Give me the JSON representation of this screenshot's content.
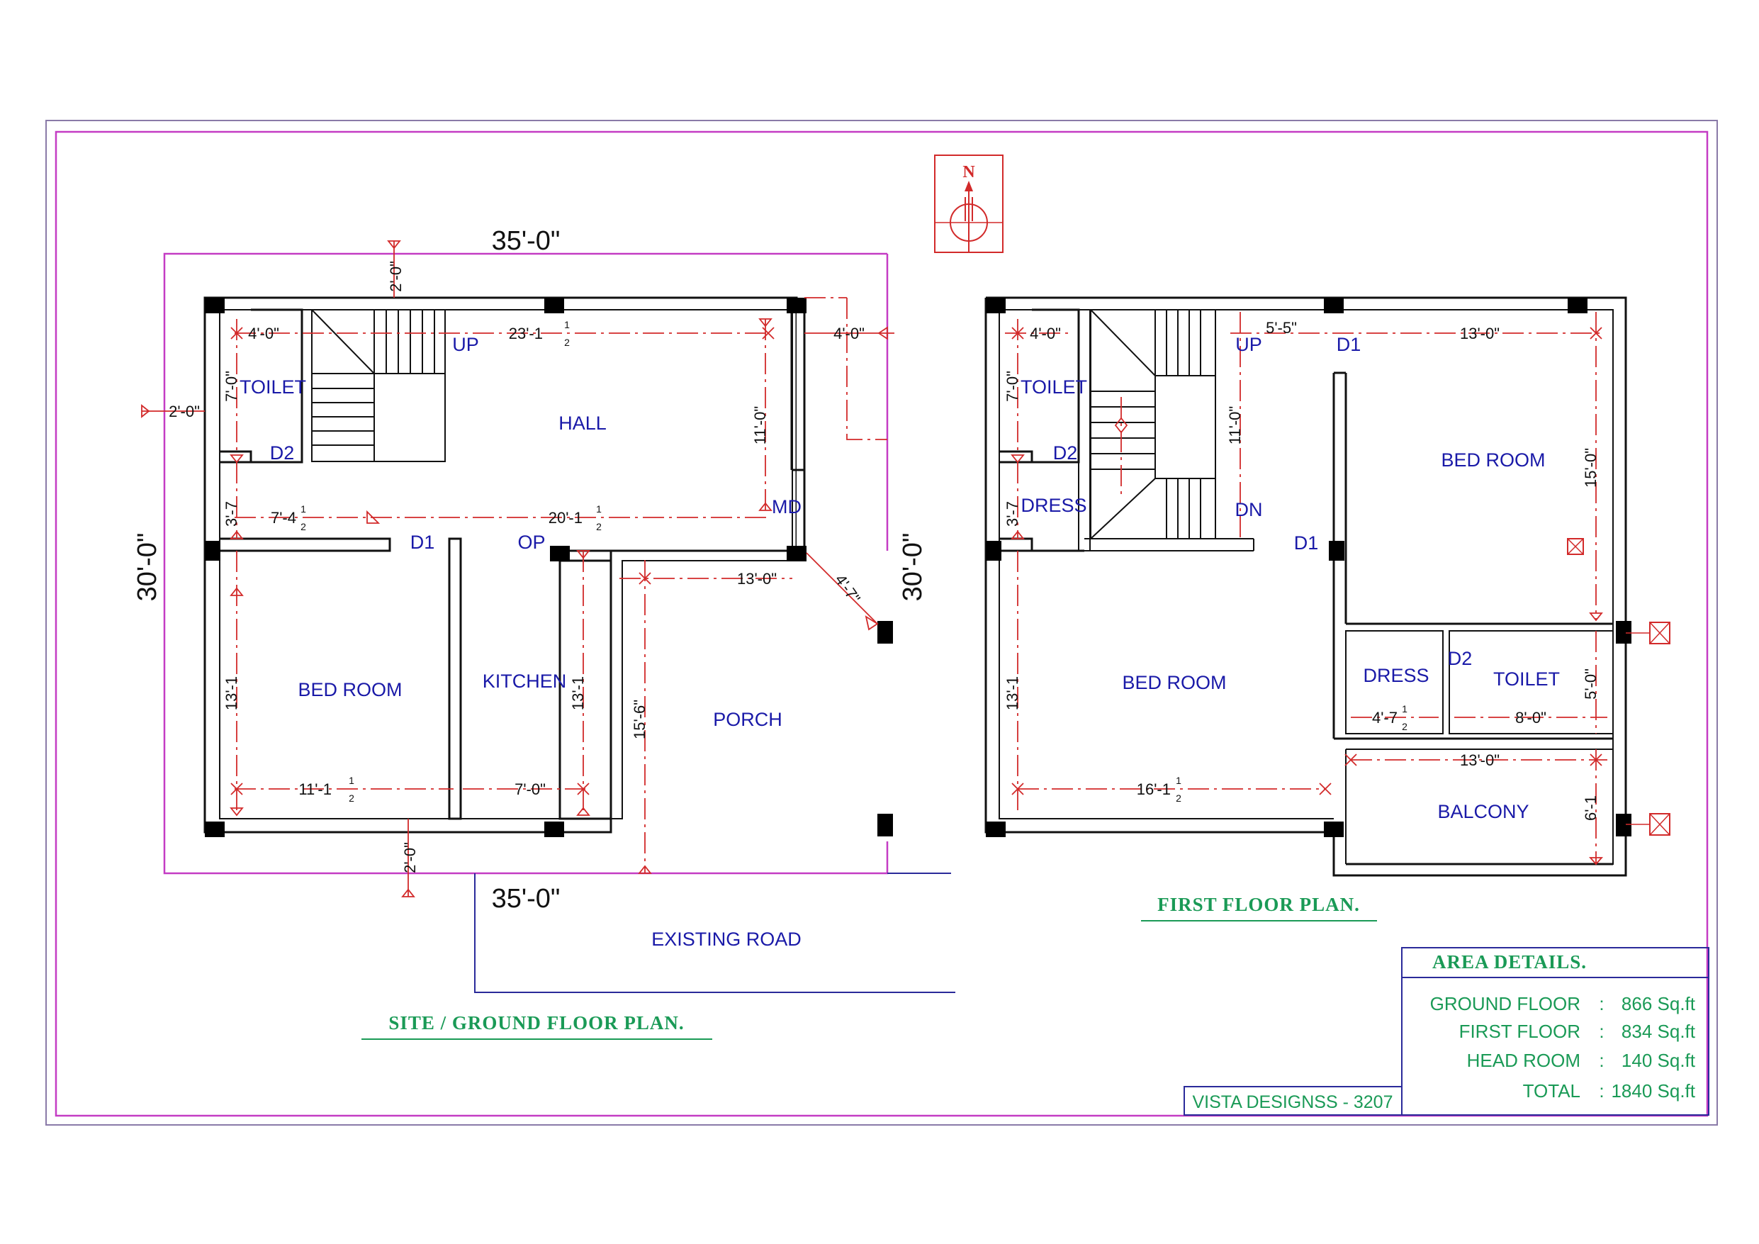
{
  "ground_floor": {
    "title": "SITE / GROUND FLOOR PLAN.",
    "width_top": "35'-0\"",
    "width_bottom": "35'-0\"",
    "depth_left": "30'-0\"",
    "depth_right": "30'-0\"",
    "rooms": {
      "hall": "HALL",
      "toilet": "TOILET",
      "bedroom": "BED ROOM",
      "kitchen": "KITCHEN",
      "porch": "PORCH"
    },
    "labels": {
      "up": "UP",
      "d2": "D2",
      "d1": "D1",
      "op": "OP",
      "md": "MD"
    },
    "dims": {
      "top_setback": "2'-0\"",
      "bottom_setback": "2'-0\"",
      "left_setback": "2'-0\"",
      "right_setback": "4'-0\"",
      "toilet_w": "4'-0\"",
      "toilet_h": "7'-0\"",
      "hall_w": "23'-1",
      "hall_h": "11'-0\"",
      "passage_left": "7'-4",
      "passage_right": "20'-1",
      "passage_h": "3'-7",
      "bedroom_h": "13'-1",
      "bedroom_w": "11'-1",
      "kitchen_h": "13'-1",
      "kitchen_w": "7'-0\"",
      "porch_w": "13'-0\"",
      "porch_h": "15'-6\"",
      "gate": "4'-7\""
    },
    "road": "EXISTING ROAD"
  },
  "first_floor": {
    "title": "FIRST FLOOR PLAN.",
    "rooms": {
      "toilet_left": "TOILET",
      "dress_left": "DRESS",
      "bedroom_left": "BED ROOM",
      "bedroom_right": "BED ROOM",
      "dress_right": "DRESS",
      "toilet_right": "TOILET",
      "balcony": "BALCONY"
    },
    "labels": {
      "up": "UP",
      "dn": "DN",
      "d1_top": "D1",
      "d1_mid": "D1",
      "d2_left": "D2",
      "d2_right": "D2"
    },
    "dims": {
      "toilet_w": "4'-0\"",
      "toilet_h": "7'-0\"",
      "dress_h": "3'-7",
      "stair_w": "5'-5\"",
      "stair_h": "11'-0\"",
      "bed_right_w": "13'-0\"",
      "bed_right_h": "15'-0\"",
      "bed_left_h": "13'-1",
      "bed_left_w": "16'-1",
      "dress_w": "4'-7",
      "toilet_right_w": "8'-0\"",
      "toilet_right_h": "5'-0\"",
      "balcony_w": "13'-0\"",
      "balcony_h": "6'-1"
    }
  },
  "north": "N",
  "area_details": {
    "heading": "AREA DETAILS.",
    "rows": [
      {
        "label": "GROUND FLOOR",
        "sep": ":",
        "value": "866 Sq.ft"
      },
      {
        "label": "FIRST FLOOR",
        "sep": ":",
        "value": "834 Sq.ft"
      },
      {
        "label": "HEAD ROOM",
        "sep": ":",
        "value": "140 Sq.ft"
      },
      {
        "label": "TOTAL",
        "sep": ":",
        "value": "1840 Sq.ft"
      }
    ]
  },
  "designer": "VISTA DESIGNSS - 3207",
  "fraction": {
    "num": "1",
    "den": "2"
  },
  "colors": {
    "wall": "#111111",
    "dimension": "#d22a2a",
    "room_text": "#1a1aa8",
    "title": "#1a9a56",
    "site_boundary": "#c43cc4",
    "road": "#2a2a9a",
    "frame_outer": "#8a7aa8"
  }
}
